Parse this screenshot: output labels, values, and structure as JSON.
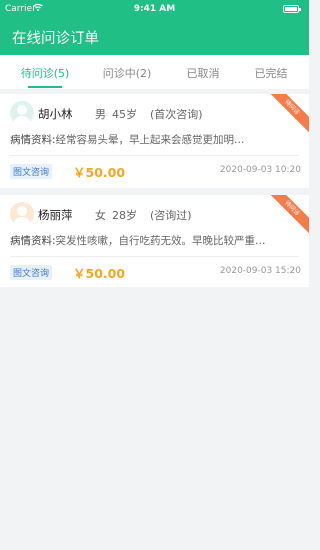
{
  "status_bar": {
    "carrier": "Carrier",
    "time": "9:41 AM",
    "wifi_icon": "wifi-icon",
    "battery_icon": "battery-icon"
  },
  "header": {
    "title": "在线问诊订单"
  },
  "tabs": [
    {
      "label": "待问诊(5)"
    },
    {
      "label": "问诊中(2)"
    },
    {
      "label": "已取消"
    },
    {
      "label": "已完结"
    }
  ],
  "orders": [
    {
      "avatar_color": "#dff3ee",
      "name": "胡小林",
      "gender": "男",
      "age": "45岁",
      "visit": "(首次咨询)",
      "ribbon": "待问诊",
      "desc_label": "病情资料:",
      "desc": "经常容易头晕，早上起来会感觉更加明…",
      "tag": "图文咨询",
      "price": "￥50.00",
      "datetime": "2020-09-03   10:20"
    },
    {
      "avatar_color": "#fde9d2",
      "name": "杨丽萍",
      "gender": "女",
      "age": "28岁",
      "visit": "(咨询过)",
      "ribbon": "待问诊",
      "desc_label": "病情资料:",
      "desc": "突发性咳嗽，自行吃药无效。早晚比较严重…",
      "tag": "图文咨询",
      "price": "￥50.00",
      "datetime": "2020-09-03   15:20"
    }
  ],
  "colors": {
    "primary": "#1fbf86",
    "price": "#f5a623",
    "ribbon": "#f47b4a"
  }
}
